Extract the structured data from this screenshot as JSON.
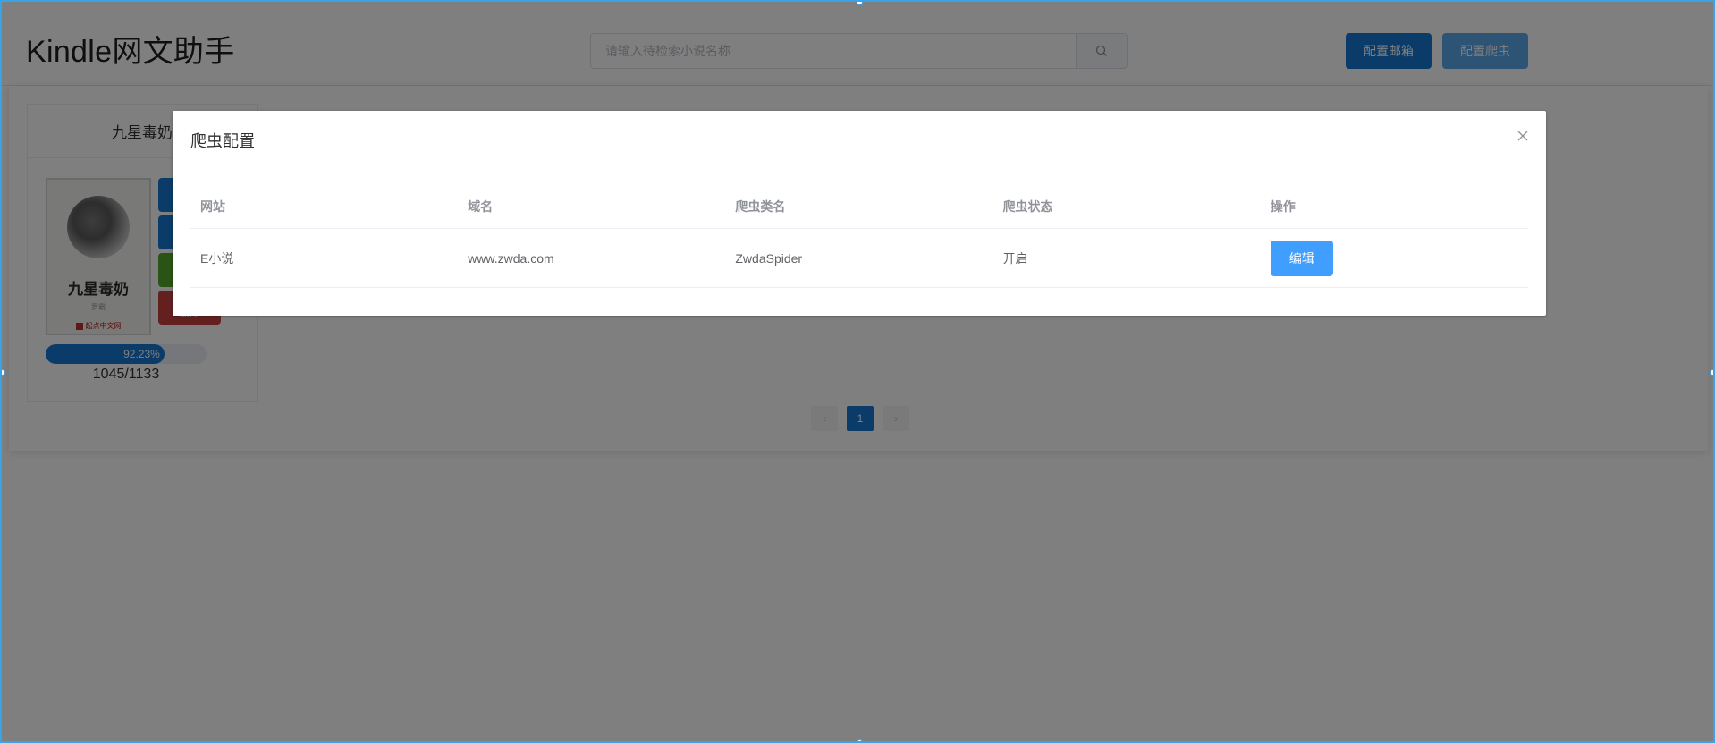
{
  "app": {
    "title": "Kindle网文助手"
  },
  "header": {
    "search_placeholder": "请输入待检索小说名称",
    "buttons": {
      "config_mail": "配置邮箱",
      "config_spider": "配置爬虫"
    }
  },
  "book": {
    "title": "九星毒奶",
    "cover": {
      "title": "九星毒奶",
      "author": "罗霸",
      "publisher": "起点中文网"
    },
    "actions": [
      {
        "color": "#1677d3",
        "label": ""
      },
      {
        "color": "#1677d3",
        "label": ""
      },
      {
        "color": "#52a82a",
        "label": ""
      },
      {
        "color": "#c6403e",
        "label": "删除"
      }
    ],
    "progress_percent": 92.23,
    "progress_label": "92.23%",
    "progress_count": "1045/1133"
  },
  "pagination": {
    "prev_icon": "chevron-left-icon",
    "current": "1",
    "next_icon": "chevron-right-icon"
  },
  "dialog": {
    "title": "爬虫配置",
    "columns": [
      "网站",
      "域名",
      "爬虫类名",
      "爬虫状态",
      "操作"
    ],
    "rows": [
      {
        "site": "E小说",
        "domain": "www.zwda.com",
        "spider_class": "ZwdaSpider",
        "status": "开启",
        "action": "编辑"
      }
    ]
  },
  "colors": {
    "primary": "#1677d3",
    "edit_button": "#409eff",
    "selection_border": "#3aa2e6"
  }
}
